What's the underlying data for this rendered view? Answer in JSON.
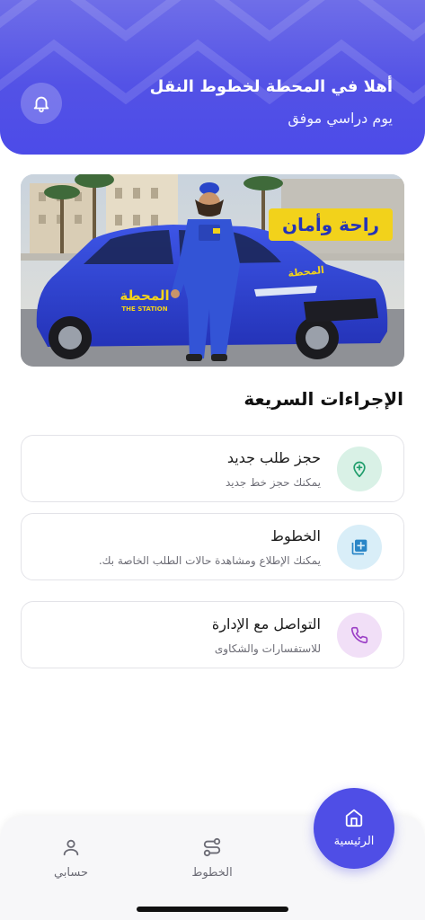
{
  "header": {
    "welcome_title": "أهلا في المحطة لخطوط النقل",
    "welcome_subtitle": "يوم دراسي موفق"
  },
  "banner": {
    "slogan": "راحة وأمان",
    "car_brand_ar": "المحطة",
    "car_brand_en": "THE STATION"
  },
  "quick_actions": {
    "title": "الإجراءات السريعة",
    "items": [
      {
        "title": "حجز طلب جديد",
        "subtitle": "يمكنك حجز خط جديد",
        "icon": "location-plus-icon",
        "color": "#d9f1e6"
      },
      {
        "title": "الخطوط",
        "subtitle": "يمكنك الإطلاع ومشاهدة حالات الطلب الخاصة بك.",
        "icon": "library-add-icon",
        "color": "#d9eef8"
      },
      {
        "title": "التواصل مع الإدارة",
        "subtitle": "للاستفسارات والشكاوى",
        "icon": "phone-icon",
        "color": "#f1dff7"
      }
    ]
  },
  "nav": {
    "home": "الرئيسية",
    "routes": "الخطوط",
    "account": "حسابي"
  },
  "colors": {
    "primary": "#4f4ee6",
    "green_icon": "#1f9d6b",
    "blue_icon": "#2a86c7",
    "purple_icon": "#9b3fc6"
  }
}
